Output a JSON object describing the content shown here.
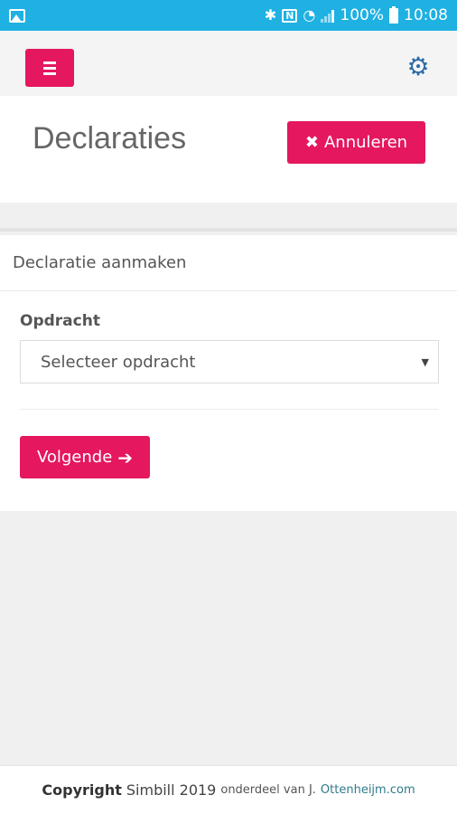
{
  "status_bar": {
    "battery_percent": "100%",
    "time": "10:08",
    "icons": [
      "gallery-icon",
      "bluetooth-icon",
      "nfc-icon",
      "wifi-icon",
      "signal-icon",
      "battery-icon"
    ]
  },
  "navbar": {
    "menu_icon": "hamburger-icon",
    "settings_icon": "gear-icon"
  },
  "header": {
    "title": "Declaraties",
    "cancel_label": "Annuleren",
    "cancel_icon": "close-icon"
  },
  "form": {
    "card_title": "Declaratie aanmaken",
    "field_label": "Opdracht",
    "select_value": "Selecteer opdracht",
    "next_label": "Volgende",
    "next_icon": "arrow-right-icon"
  },
  "footer": {
    "copyright_label": "Copyright",
    "brand_year": "Simbill 2019",
    "part_of": "onderdeel van J.",
    "link_text": "Ottenheijm.com"
  },
  "colors": {
    "status_bar": "#1eb1e2",
    "accent": "#e4175f",
    "settings_icon": "#2d6ca8",
    "link": "#2f7a8c"
  }
}
